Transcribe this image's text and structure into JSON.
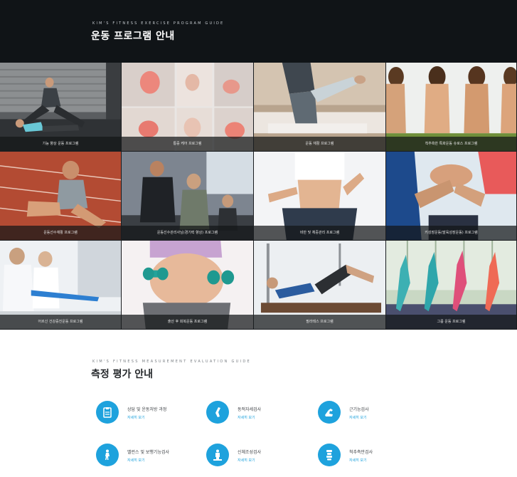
{
  "header": {
    "kicker": "KIM'S FITNESS EXERCISE PROGRAM GUIDE",
    "title": "운동 프로그램 안내"
  },
  "programs": [
    {
      "label": "기능 향상 운동 프로그램",
      "icon": "functional-training-photo"
    },
    {
      "label": "통증 케어 프로그램",
      "icon": "pain-care-photo"
    },
    {
      "label": "운동 재활 프로그램",
      "icon": "rehab-stretch-photo"
    },
    {
      "label": "척추측만 특화운동 슈로스 프로그램",
      "icon": "scoliosis-backs-photo"
    },
    {
      "label": "운동선수재활 프로그램",
      "icon": "athlete-rehab-photo"
    },
    {
      "label": "운동선수관리사님(경기력 향상) 프로그램",
      "icon": "gym-coaching-photo"
    },
    {
      "label": "비만 및 체중관리 프로그램",
      "icon": "weight-loss-photo"
    },
    {
      "label": "키성장운동(발육성장운동) 프로그램",
      "icon": "kids-team-photo"
    },
    {
      "label": "어르신 건강증진운동 프로그램",
      "icon": "senior-band-photo"
    },
    {
      "label": "출산 후 회복운동 프로그램",
      "icon": "pregnancy-dumbbell-photo"
    },
    {
      "label": "필라테스 프로그램",
      "icon": "pilates-reformer-photo"
    },
    {
      "label": "그룹 운동 프로그램",
      "icon": "group-yoga-photo"
    }
  ],
  "evaluation": {
    "kicker": "KIM'S FITNESS MEASUREMENT EVALUATION GUIDE",
    "title": "측정 평가 안내",
    "items": [
      {
        "name": "상담 및 운동처방 과정",
        "more": "자세히 보기",
        "icon": "clipboard-icon"
      },
      {
        "name": "동적자세검사",
        "more": "자세히 보기",
        "icon": "leg-icon"
      },
      {
        "name": "근기능검사",
        "more": "자세히 보기",
        "icon": "muscle-arm-icon"
      },
      {
        "name": "밸런스 및 보행기능검사",
        "more": "자세히 보기",
        "icon": "walking-person-icon"
      },
      {
        "name": "신체조성검사",
        "more": "자세히 보기",
        "icon": "body-scale-icon"
      },
      {
        "name": "척추측만검사",
        "more": "자세히 보기",
        "icon": "spine-icon"
      }
    ],
    "accent": "#1ea2dd"
  }
}
